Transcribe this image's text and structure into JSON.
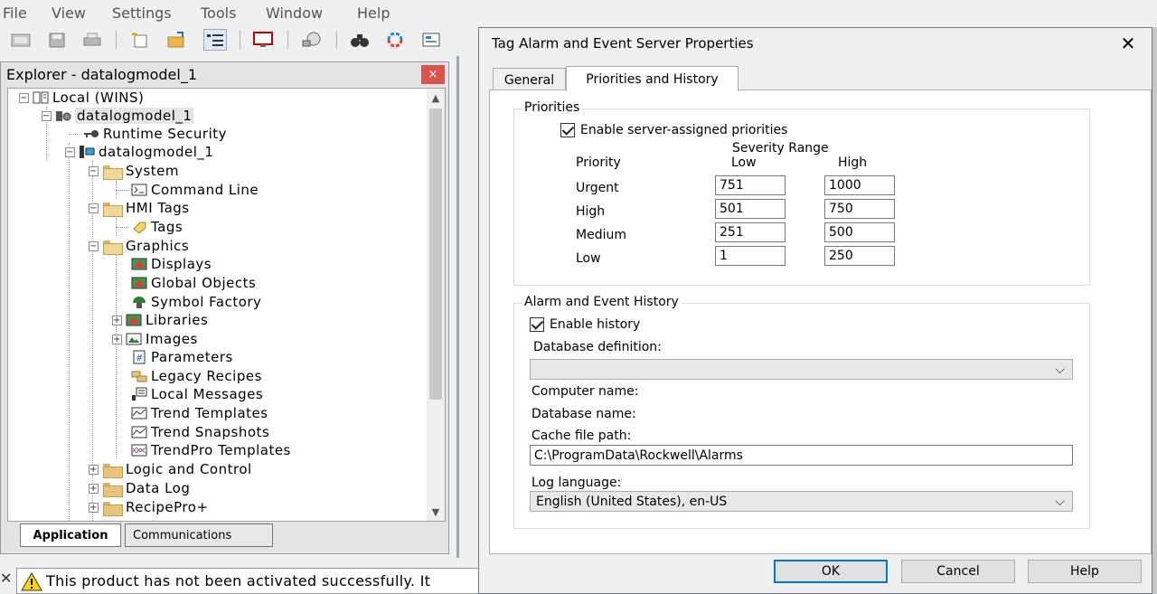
{
  "menubar": {
    "items": [
      "File",
      "View",
      "Settings",
      "Tools",
      "Window",
      "Help"
    ]
  },
  "toolbar": {
    "buttons": [
      "new-project-icon",
      "save-icon",
      "print-icon",
      "new-item-icon",
      "open-folder-icon",
      "tree-view-icon",
      "display-icon",
      "network-icon",
      "binoculars-icon",
      "refresh-icon",
      "properties-icon"
    ]
  },
  "explorer": {
    "title": "Explorer - datalogmodel_1",
    "close_glyph": "×",
    "tree": {
      "root": "Local (WINS)",
      "app": "datalogmodel_1",
      "runtime_security": "Runtime Security",
      "project": "datalogmodel_1",
      "system": "System",
      "command_line": "Command Line",
      "hmi_tags": "HMI Tags",
      "tags": "Tags",
      "graphics": "Graphics",
      "displays": "Displays",
      "global_objects": "Global Objects",
      "symbol_factory": "Symbol Factory",
      "libraries": "Libraries",
      "images": "Images",
      "parameters": "Parameters",
      "legacy_recipes": "Legacy Recipes",
      "local_messages": "Local Messages",
      "trend_templates": "Trend Templates",
      "trend_snapshots": "Trend Snapshots",
      "trendpro_templates": "TrendPro Templates",
      "logic_and_control": "Logic and Control",
      "data_log": "Data Log",
      "recipepro": "RecipePro+"
    },
    "tabs": {
      "application": "Application",
      "communications": "Communications"
    }
  },
  "status": {
    "message": "This product has not been activated successfully. It"
  },
  "dialog": {
    "title": "Tag Alarm and Event Server Properties",
    "close_glyph": "✕",
    "tabs": {
      "general": "General",
      "priorities_history": "Priorities and History"
    },
    "priorities": {
      "legend": "Priorities",
      "enable_label": "Enable server-assigned priorities",
      "enable_checked": true,
      "severity_range_label": "Severity Range",
      "col_priority": "Priority",
      "col_low": "Low",
      "col_high": "High",
      "rows": [
        {
          "name": "Urgent",
          "low": "751",
          "high": "1000"
        },
        {
          "name": "High",
          "low": "501",
          "high": "750"
        },
        {
          "name": "Medium",
          "low": "251",
          "high": "500"
        },
        {
          "name": "Low",
          "low": "1",
          "high": "250"
        }
      ]
    },
    "history": {
      "legend": "Alarm and Event History",
      "enable_label": "Enable history",
      "enable_checked": true,
      "database_definition_label": "Database definition:",
      "database_definition_value": "",
      "computer_name_label": "Computer name:",
      "database_name_label": "Database name:",
      "cache_file_path_label": "Cache file path:",
      "cache_file_path_value": "C:\\ProgramData\\Rockwell\\Alarms",
      "log_language_label": "Log language:",
      "log_language_value": "English (United States), en-US"
    },
    "buttons": {
      "ok": "OK",
      "cancel": "Cancel",
      "help": "Help"
    }
  }
}
